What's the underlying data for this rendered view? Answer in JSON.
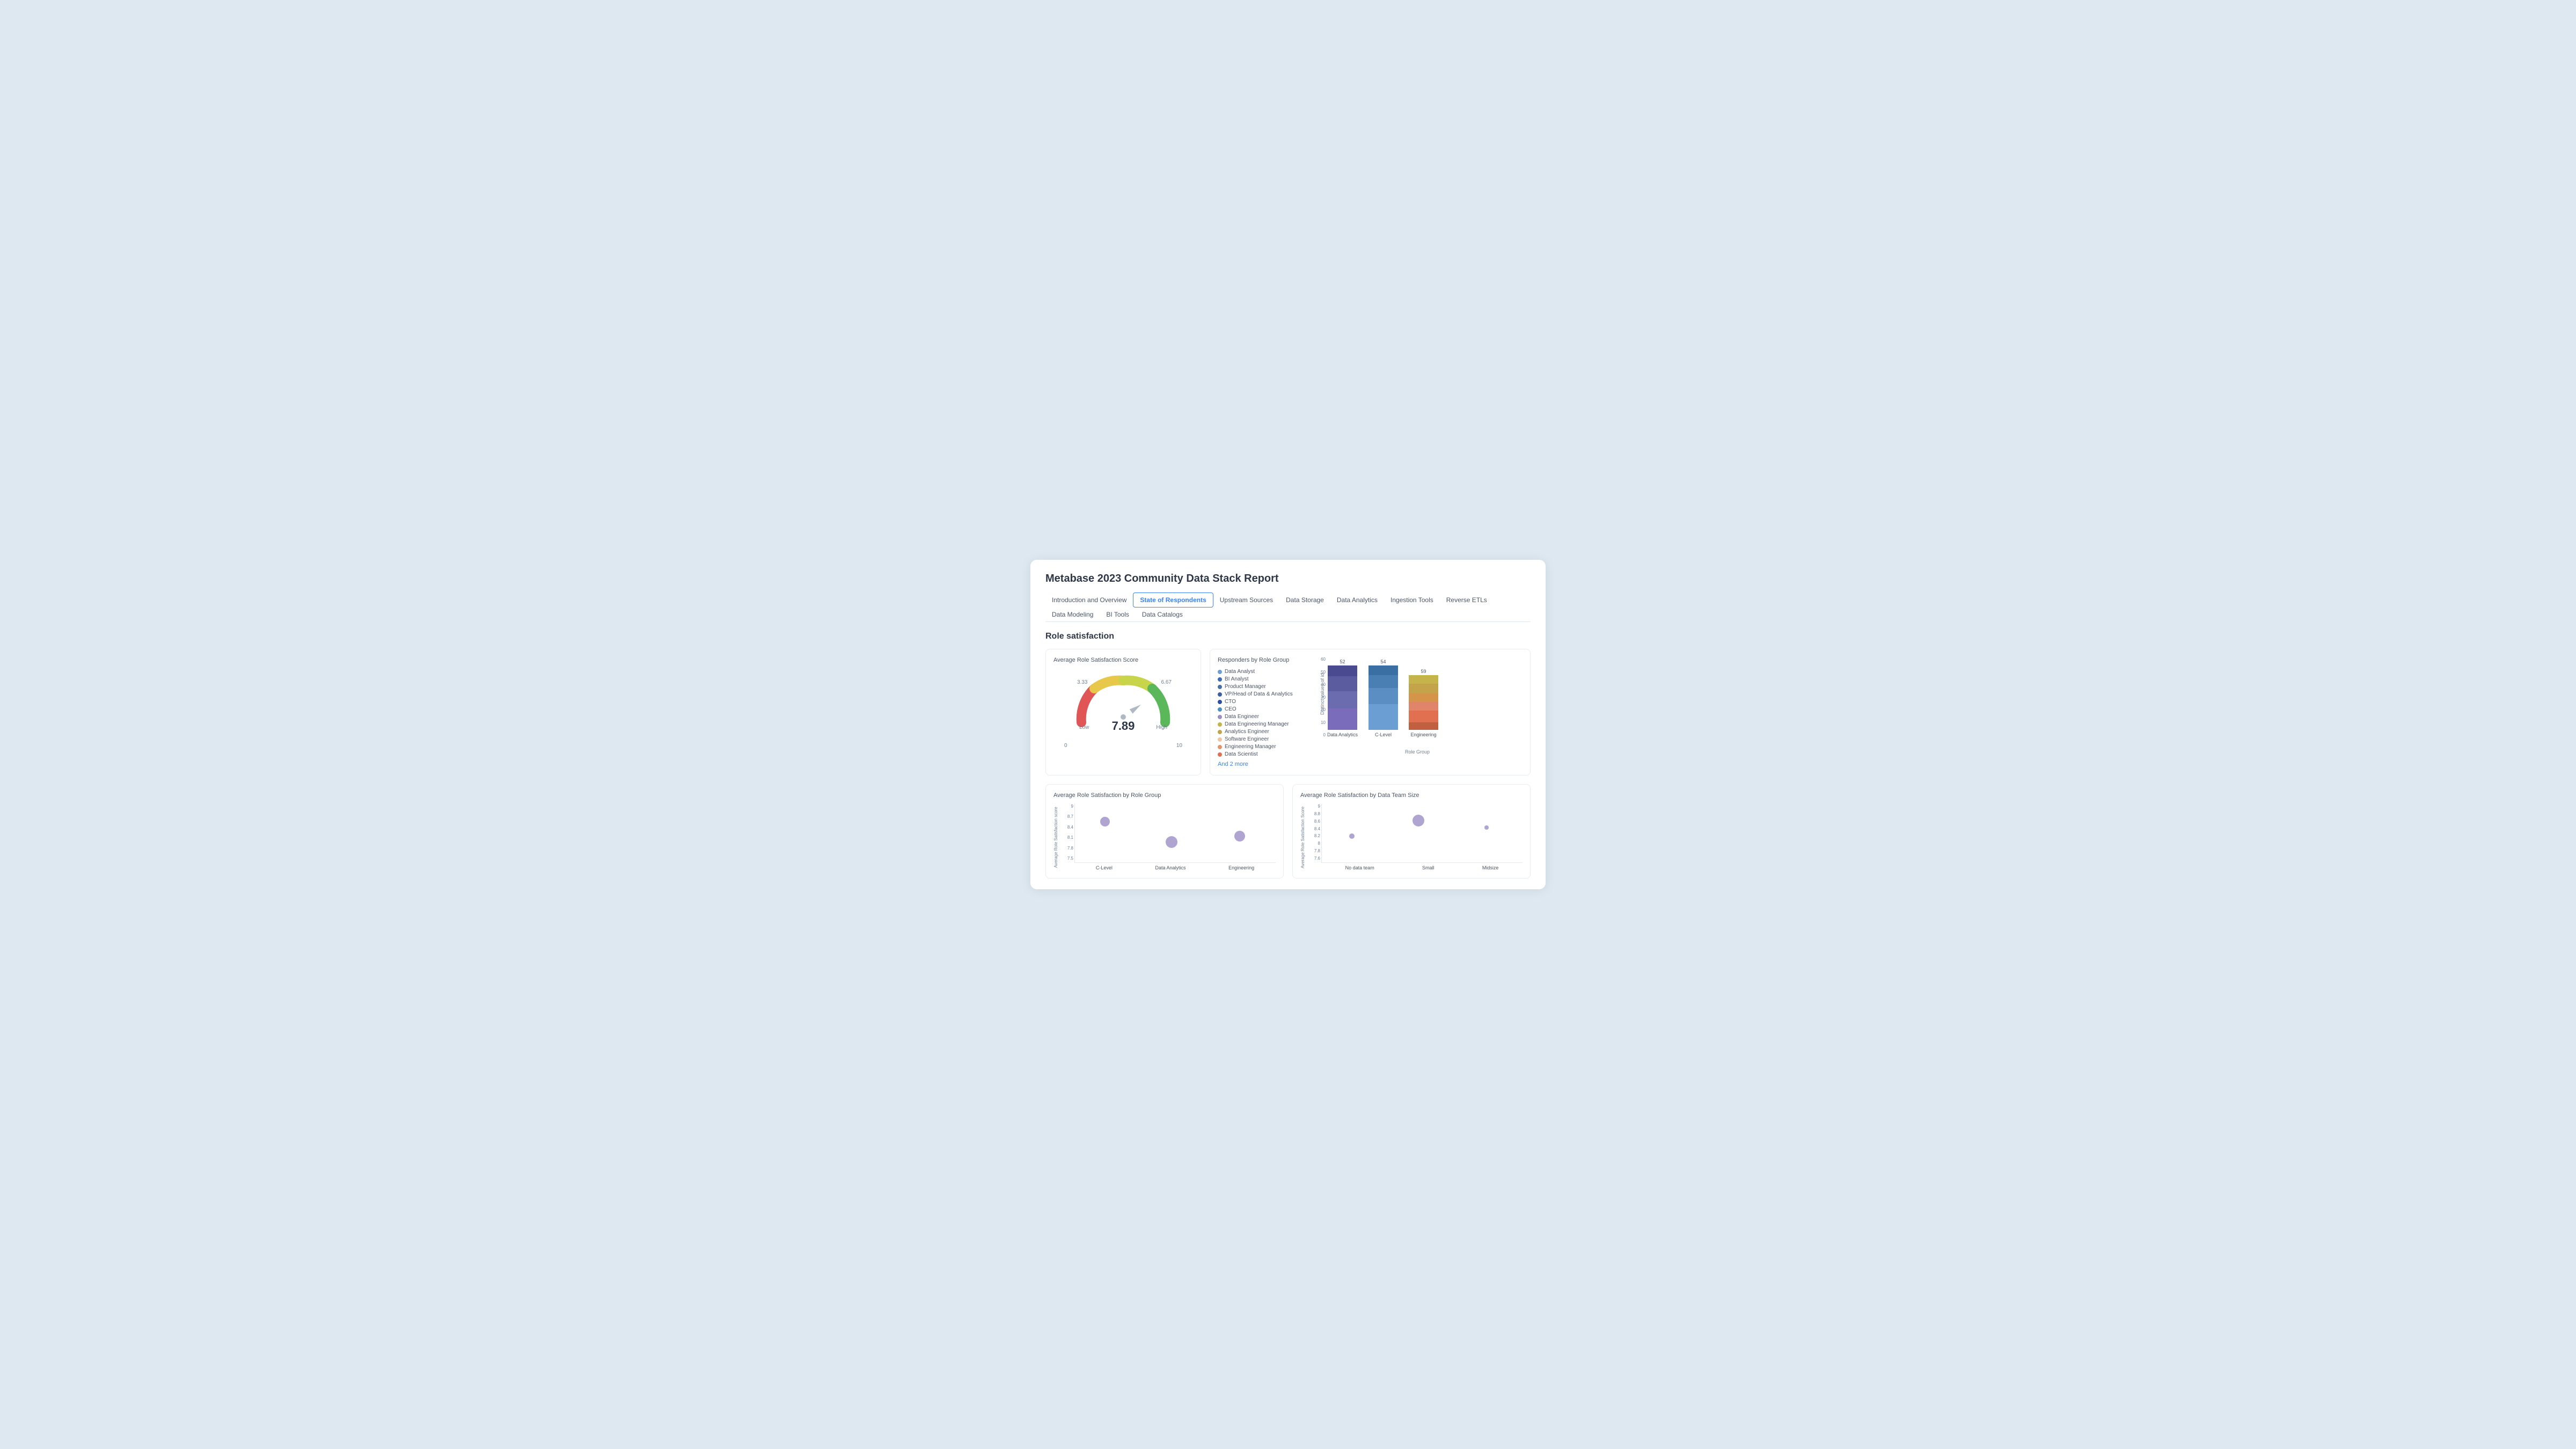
{
  "title": "Metabase 2023 Community Data Stack Report",
  "tabs": [
    {
      "label": "Introduction and Overview",
      "active": false
    },
    {
      "label": "State of Respondents",
      "active": true
    },
    {
      "label": "Upstream Sources",
      "active": false
    },
    {
      "label": "Data Storage",
      "active": false
    },
    {
      "label": "Data Analytics",
      "active": false
    },
    {
      "label": "Ingestion Tools",
      "active": false
    },
    {
      "label": "Reverse ETLs",
      "active": false
    },
    {
      "label": "Data Modeling",
      "active": false
    },
    {
      "label": "BI Tools",
      "active": false
    },
    {
      "label": "Data Catalogs",
      "active": false
    }
  ],
  "section": "Role satisfaction",
  "gauge": {
    "title": "Average Role Satisfaction Score",
    "value": "7.89",
    "low": "Low",
    "high": "High",
    "label_333": "3.33",
    "label_667": "6.67",
    "label_0": "0",
    "label_10": "10"
  },
  "responders_chart": {
    "title": "Responders by Role Group",
    "legend": [
      {
        "label": "Data Analyst",
        "color": "#6b9fd4"
      },
      {
        "label": "BI Analyst",
        "color": "#3b6cb7"
      },
      {
        "label": "Product Manager",
        "color": "#4a6fa5"
      },
      {
        "label": "VP/Head of Data & Analytics",
        "color": "#3b5fa0"
      },
      {
        "label": "CTO",
        "color": "#2b4fa0"
      },
      {
        "label": "CEO",
        "color": "#4a90c4"
      },
      {
        "label": "Data Engineer",
        "color": "#9b8ec4"
      },
      {
        "label": "Data Engineering Manager",
        "color": "#c4b44a"
      },
      {
        "label": "Analytics Engineer",
        "color": "#c4a44a"
      },
      {
        "label": "Software Engineer",
        "color": "#f0c4a0"
      },
      {
        "label": "Engineering Manager",
        "color": "#e0956a"
      },
      {
        "label": "Data Scientist",
        "color": "#e07050"
      }
    ],
    "and_more": "And 2 more",
    "bars": [
      {
        "label": "Data Analytics",
        "count": 52,
        "segments": [
          {
            "color": "#7b6bbb",
            "height": 60
          },
          {
            "color": "#5b5ba0",
            "height": 40
          },
          {
            "color": "#4a4a90",
            "height": 25
          },
          {
            "color": "#3a3a80",
            "height": 15
          }
        ]
      },
      {
        "label": "C-Level",
        "count": 54,
        "segments": [
          {
            "color": "#6b9fd4",
            "height": 55
          },
          {
            "color": "#5b8fc4",
            "height": 30
          },
          {
            "color": "#4a7fb4",
            "height": 20
          },
          {
            "color": "#3a6fa4",
            "height": 12
          }
        ]
      },
      {
        "label": "Engineering",
        "count": 59,
        "segments": [
          {
            "color": "#c4b44a",
            "height": 28
          },
          {
            "color": "#c4a44a",
            "height": 22
          },
          {
            "color": "#d4944a",
            "height": 18
          },
          {
            "color": "#e0846a",
            "height": 15
          },
          {
            "color": "#e07050",
            "height": 18
          },
          {
            "color": "#d06040",
            "height": 14
          }
        ]
      }
    ],
    "y_ticks": [
      "60",
      "50",
      "40",
      "30",
      "20",
      "10",
      "0"
    ],
    "y_axis_label": "Distinct values of id",
    "x_axis_label": "Role Group"
  },
  "satisfaction_by_role": {
    "title": "Average Role Satisfaction by Role Group",
    "y_label": "Average Role Satisfaction score",
    "y_ticks": [
      "9",
      "8.7",
      "8.4",
      "8.1",
      "7.8",
      "7.5"
    ],
    "bubbles": [
      {
        "label": "C-Level",
        "x_pct": 15,
        "y_pct": 30,
        "size": 18
      },
      {
        "label": "Data Analytics",
        "x_pct": 48,
        "y_pct": 65,
        "size": 22
      },
      {
        "label": "Engineering",
        "x_pct": 82,
        "y_pct": 55,
        "size": 20
      }
    ]
  },
  "satisfaction_by_team": {
    "title": "Average Role Satisfaction by Data Team Size",
    "y_label": "Average Role Satisfaction Score",
    "y_ticks": [
      "9",
      "8.8",
      "8.6",
      "8.4",
      "8.2",
      "8",
      "7.8",
      "7.6"
    ],
    "bubbles": [
      {
        "label": "No data team",
        "x_pct": 15,
        "y_pct": 55,
        "size": 10
      },
      {
        "label": "Small",
        "x_pct": 48,
        "y_pct": 28,
        "size": 22
      },
      {
        "label": "Midsize",
        "x_pct": 82,
        "y_pct": 40,
        "size": 8
      }
    ]
  }
}
